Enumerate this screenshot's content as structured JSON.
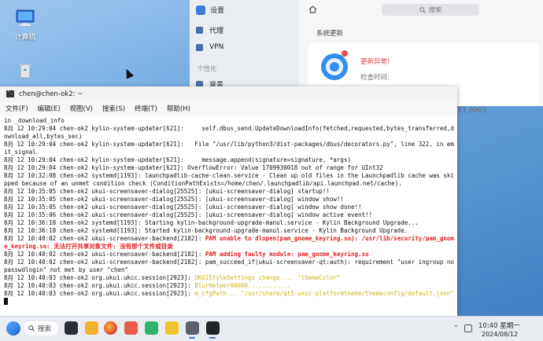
{
  "desktop": {
    "icons": [
      {
        "label": "计算机",
        "icon": "computer-icon"
      },
      {
        "label": "",
        "icon": "recycle-bin-icon"
      }
    ]
  },
  "settings": {
    "title": "设置",
    "sidebar": [
      {
        "label": "代理",
        "icon": "proxy-icon"
      },
      {
        "label": "VPN",
        "icon": "vpn-icon"
      },
      {
        "label": "背景",
        "icon": "background-icon"
      }
    ],
    "group_label": "个性化",
    "search_placeholder": "搜索",
    "section_title": "系统更新",
    "update_status": "更新异常!",
    "check_time_label": "检查时间:",
    "peek_text": "73.0003"
  },
  "terminal": {
    "title": "chen@chen-ok2: ~",
    "menu": [
      "文件(F)",
      "编辑(E)",
      "视图(V)",
      "搜索(S)",
      "终端(T)",
      "帮助(H)"
    ],
    "lines": [
      {
        "text": "in _download_info",
        "style": "normal"
      },
      {
        "text": "8月 12 10:29:04 chen-ok2 kylin-system-updater[621]:     self.dbus_send.UpdateDownloadInfo(fetched,requested,bytes_transferred,download_all,bytes_sec)",
        "style": "normal"
      },
      {
        "text": "8月 12 10:29:04 chen-ok2 kylin-system-updater[621]:   File \"/usr/lib/python3/dist-packages/dbus/decorators.py\", line 322, in emit_signal",
        "style": "normal"
      },
      {
        "text": "8月 12 10:29:04 chen-ok2 kylin-system-updater[621]:     message.append(signature=signature, *args)",
        "style": "normal"
      },
      {
        "text": "8月 12 10:29:04 chen-ok2 kylin-system-updater[621]: OverflowError: Value 1709930018 out of range for UInt32",
        "style": "normal"
      },
      {
        "text": "8月 12 10:32:08 chen-ok2 systemd[1193]: launchpadlib-cache-clean.service - Clean up old files in the Launchpadlib cache was skipped because of an unmet condition check (ConditionPathExists=/home/chen/.launchpadlib/api.launchpad.net/cache).",
        "style": "normal"
      },
      {
        "text": "8月 12 10:35:05 chen-ok2 ukui-screensaver-dialog[25525]: [ukui-screensaver-dialog] startup!!",
        "style": "normal"
      },
      {
        "text": "8月 12 10:35:05 chen-ok2 ukui-screensaver-dialog[25525]: [ukui-screensaver-dialog] window show!!",
        "style": "normal"
      },
      {
        "text": "8月 12 10:35:05 chen-ok2 ukui-screensaver-dialog[25525]: [ukui-screensaver-dialog] window show done!!",
        "style": "normal"
      },
      {
        "text": "8月 12 10:35:06 chen-ok2 ukui-screensaver-dialog[25525]: [ukui-screensaver-dialog] window active event!!",
        "style": "normal"
      },
      {
        "text": "8月 12 10:36:18 chen-ok2 systemd[1193]: Starting kylin-background-upgrade-manul.service - Kylin Background Upgrade...",
        "style": "normal"
      },
      {
        "text": "8月 12 10:36:18 chen-ok2 systemd[1193]: Started kylin-background-upgrade-manul.service - Kylin Background Upgrade.",
        "style": "normal"
      },
      {
        "text": "8月 12 10:40:02 chen-ok2 ukui-screensaver-backend[2182]: PAM unable to dlopen(pam_gnome_keyring.so): /usr/lib/security/pam_gnome_keyring.so: 无法打开共享对象文件: 没有那个文件或目录",
        "style": "red",
        "prefix": "8月 12 10:40:02 chen-ok2 ukui-screensaver-backend[2182]: ",
        "highlight": "PAM unable to dlopen(pam_gnome_keyring.so): /usr/lib/security/pam_gnome_keyring.so: 无法打开共享对象文件: 没有那个文件或目录"
      },
      {
        "text": "8月 12 10:40:02 chen-ok2 ukui-screensaver-backend[2182]: PAM adding faulty module: pam_gnome_keyring.so",
        "style": "red",
        "prefix": "8月 12 10:40:02 chen-ok2 ukui-screensaver-backend[2182]: ",
        "highlight": "PAM adding faulty module: pam_gnome_keyring.so"
      },
      {
        "text": "8月 12 10:40:02 chen-ok2 ukui-screensaver-backend[2182]: pam_succeed_if(ukui-screensaver-qt:auth): requirement \"user ingroup nopasswdlogin\" not met by user \"chen\"",
        "style": "normal"
      },
      {
        "text": "8月 12 10:40:03 chen-ok2 org.ukui.ukcc.session[2923]: UKUIStyleSettings change.... \"themeColor\"",
        "style": "yellow",
        "prefix": "8月 12 10:40:03 chen-ok2 org.ukui.ukcc.session[2923]: ",
        "highlight": "UKUIStyleSettings change.... \"themeColor\""
      },
      {
        "text": "8月 12 10:40:03 chen-ok2 org.ukui.ukcc.session[2923]: BlurHelper00000............",
        "style": "yellow",
        "prefix": "8月 12 10:40:03 chen-ok2 org.ukui.ukcc.session[2923]: ",
        "highlight": "BlurHelper00000............"
      },
      {
        "text": "8月 12 10:40:03 chen-ok2 org.ukui.ukcc.session[2923]: m_cfgPath... \"/usr/share/qt5-ukui-platformtheme/themeconfig/default.json\"",
        "style": "yellow",
        "prefix": "8月 12 10:40:03 chen-ok2 org.ukui.ukcc.session[2923]: ",
        "highlight": "m_cfgPath... \"/usr/share/qt5-ukui-platformtheme/themeconfig/default.json\""
      }
    ]
  },
  "taskbar": {
    "search_label": "搜索",
    "apps": [
      "multitask-view-icon",
      "file-manager-icon",
      "firefox-icon",
      "software-store-icon",
      "calendar-icon",
      "notes-icon",
      "settings-icon",
      "terminal-icon"
    ],
    "time": "10:40 星期一",
    "date": "2024/08/12",
    "colors": {
      "accent": "#3c78d8",
      "error": "#e02020",
      "warning_text": "#c9b414"
    }
  }
}
